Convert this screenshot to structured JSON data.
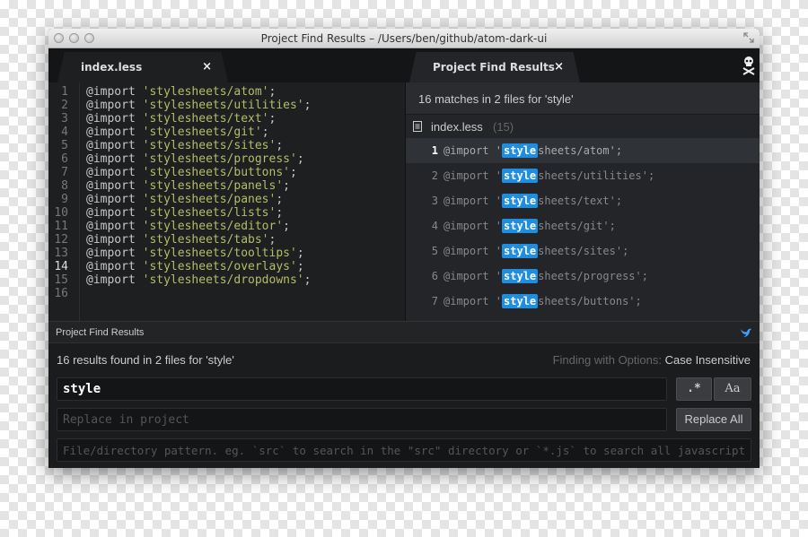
{
  "window": {
    "title": "Project Find Results – /Users/ben/github/atom-dark-ui"
  },
  "tabs": [
    {
      "label": "index.less",
      "close_icon": "×"
    },
    {
      "label": "Project Find Results",
      "close_icon": "×"
    }
  ],
  "editor": {
    "active_line": 14,
    "lines": [
      {
        "num": "1",
        "prefix": "@import ",
        "str": "'stylesheets/atom'",
        "suffix": ";"
      },
      {
        "num": "2",
        "prefix": "@import ",
        "str": "'stylesheets/utilities'",
        "suffix": ";"
      },
      {
        "num": "3",
        "prefix": "@import ",
        "str": "'stylesheets/text'",
        "suffix": ";"
      },
      {
        "num": "4",
        "prefix": "@import ",
        "str": "'stylesheets/git'",
        "suffix": ";"
      },
      {
        "num": "5",
        "prefix": "@import ",
        "str": "'stylesheets/sites'",
        "suffix": ";"
      },
      {
        "num": "6",
        "prefix": "@import ",
        "str": "'stylesheets/progress'",
        "suffix": ";"
      },
      {
        "num": "7",
        "prefix": "@import ",
        "str": "'stylesheets/buttons'",
        "suffix": ";"
      },
      {
        "num": "8",
        "prefix": "@import ",
        "str": "'stylesheets/panels'",
        "suffix": ";"
      },
      {
        "num": "9",
        "prefix": "@import ",
        "str": "'stylesheets/panes'",
        "suffix": ";"
      },
      {
        "num": "10",
        "prefix": "@import ",
        "str": "'stylesheets/lists'",
        "suffix": ";"
      },
      {
        "num": "11",
        "prefix": "@import ",
        "str": "'stylesheets/editor'",
        "suffix": ";"
      },
      {
        "num": "12",
        "prefix": "@import ",
        "str": "'stylesheets/tabs'",
        "suffix": ";"
      },
      {
        "num": "13",
        "prefix": "@import ",
        "str": "'stylesheets/tooltips'",
        "suffix": ";"
      },
      {
        "num": "14",
        "prefix": "@import ",
        "str": "'stylesheets/overlays'",
        "suffix": ";"
      },
      {
        "num": "15",
        "prefix": "@import ",
        "str": "'stylesheets/dropdowns'",
        "suffix": ";"
      },
      {
        "num": "16",
        "prefix": "",
        "str": "",
        "suffix": ""
      }
    ]
  },
  "results": {
    "header": "16 matches in 2 files for 'style'",
    "file": {
      "name": "index.less",
      "count": "(15)"
    },
    "matches": [
      {
        "num": "1",
        "before": "@import '",
        "match": "style",
        "after": "sheets/atom';"
      },
      {
        "num": "2",
        "before": "@import '",
        "match": "style",
        "after": "sheets/utilities';"
      },
      {
        "num": "3",
        "before": "@import '",
        "match": "style",
        "after": "sheets/text';"
      },
      {
        "num": "4",
        "before": "@import '",
        "match": "style",
        "after": "sheets/git';"
      },
      {
        "num": "5",
        "before": "@import '",
        "match": "style",
        "after": "sheets/sites';"
      },
      {
        "num": "6",
        "before": "@import '",
        "match": "style",
        "after": "sheets/progress';"
      },
      {
        "num": "7",
        "before": "@import '",
        "match": "style",
        "after": "sheets/buttons';"
      }
    ]
  },
  "find_panel": {
    "title": "Project Find Results",
    "status": "16 results found in 2 files for 'style'",
    "options_label": "Finding with Options: ",
    "options_value": "Case Insensitive",
    "find_value": "style",
    "regex_button": ".*",
    "case_button": "Aa",
    "replace_placeholder": "Replace in project",
    "replace_all_button": "Replace All",
    "path_placeholder": "File/directory pattern. eg. `src` to search in the \"src\" directory or `*.js` to search all javascript files."
  },
  "colors": {
    "highlight": "#1f8ee0",
    "string": "#b5bd68",
    "bird_icon": "#3aa0ff"
  }
}
